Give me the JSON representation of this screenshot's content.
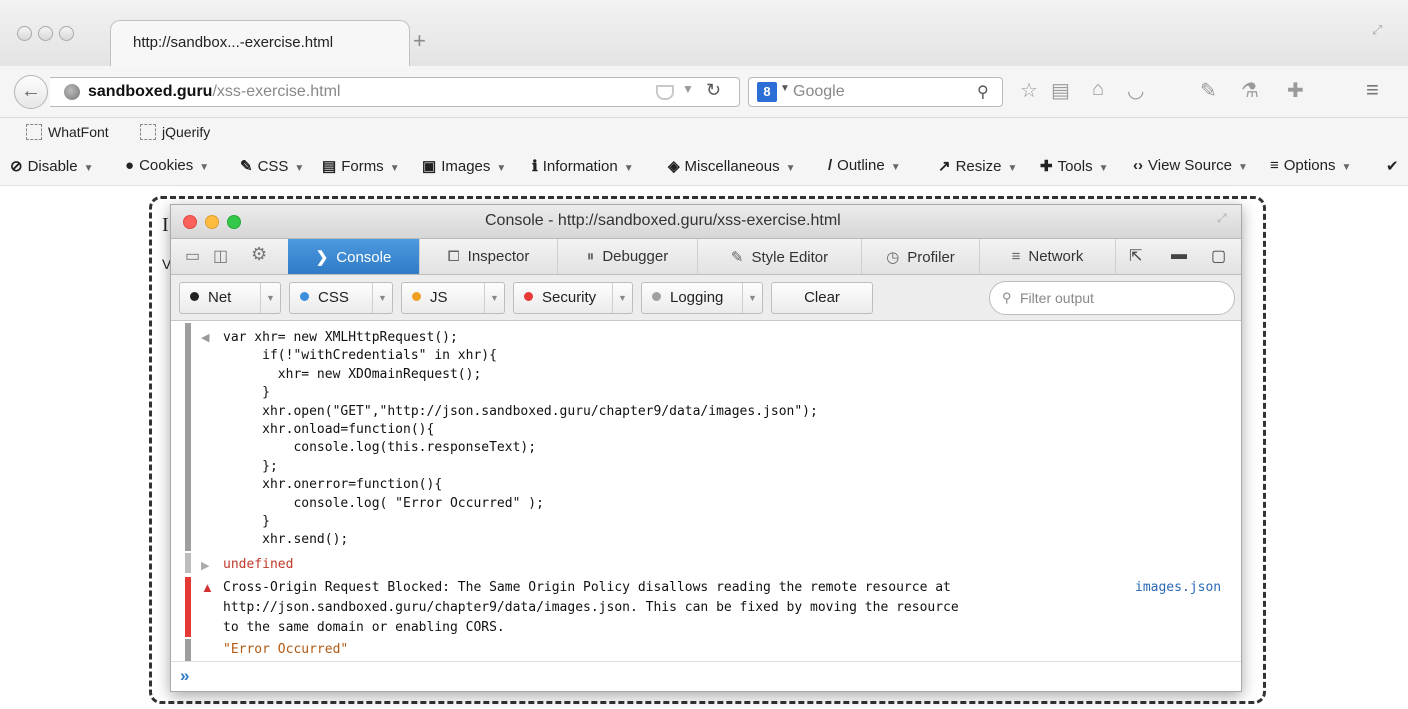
{
  "browser": {
    "tab_title": "http://sandbox...-exercise.html",
    "new_tab_symbol": "+",
    "url_host": "sandboxed.guru",
    "url_path": "/xss-exercise.html",
    "search_engine_label": "Google"
  },
  "bookmarks": [
    {
      "label": "WhatFont"
    },
    {
      "label": "jQuerify"
    }
  ],
  "web_developer_toolbar": [
    {
      "label": "Disable",
      "icon": "⊘"
    },
    {
      "label": "Cookies",
      "icon": "●"
    },
    {
      "label": "CSS",
      "icon": "✎"
    },
    {
      "label": "Forms",
      "icon": "▤"
    },
    {
      "label": "Images",
      "icon": "▣"
    },
    {
      "label": "Information",
      "icon": "ℹ"
    },
    {
      "label": "Miscellaneous",
      "icon": "◈"
    },
    {
      "label": "Outline",
      "icon": "/"
    },
    {
      "label": "Resize",
      "icon": "↗"
    },
    {
      "label": "Tools",
      "icon": "✚"
    },
    {
      "label": "View Source",
      "icon": "‹›"
    },
    {
      "label": "Options",
      "icon": "≡"
    }
  ],
  "page": {
    "partial_char_1": "I",
    "partial_char_2": "V"
  },
  "console": {
    "window_title": "Console - http://sandboxed.guru/xss-exercise.html",
    "tabs": [
      {
        "label": "Console",
        "icon": "❯",
        "active": true
      },
      {
        "label": "Inspector",
        "icon": "⧠"
      },
      {
        "label": "Debugger",
        "icon": "⏸"
      },
      {
        "label": "Style Editor",
        "icon": "✎"
      },
      {
        "label": "Profiler",
        "icon": "◷"
      },
      {
        "label": "Network",
        "icon": "≡"
      }
    ],
    "filters": [
      {
        "label": "Net",
        "color": "#222222"
      },
      {
        "label": "CSS",
        "color": "#3b8fdc"
      },
      {
        "label": "JS",
        "color": "#f0a020"
      },
      {
        "label": "Security",
        "color": "#e53935"
      },
      {
        "label": "Logging",
        "color": "#a0a0a0"
      }
    ],
    "clear_label": "Clear",
    "filter_placeholder": "Filter output",
    "code_lines": [
      "var xhr= new XMLHttpRequest();",
      "     if(!\"withCredentials\" in xhr){",
      "       xhr= new XDOmainRequest();",
      "     }",
      "     xhr.open(\"GET\",\"http://json.sandboxed.guru/chapter9/data/images.json\");",
      "     xhr.onload=function(){",
      "         console.log(this.responseText);",
      "     };",
      "     xhr.onerror=function(){",
      "         console.log( \"Error Occurred\" );",
      "     }",
      "     xhr.send();"
    ],
    "result_undefined": "undefined",
    "error_lines": [
      "Cross-Origin Request Blocked: The Same Origin Policy disallows reading the remote resource at",
      "http://json.sandboxed.guru/chapter9/data/images.json. This can be fixed by moving the resource",
      "to the same domain or enabling CORS."
    ],
    "error_source": "images.json",
    "log_output": "\"Error Occurred\"",
    "prompt_symbol": "»"
  }
}
